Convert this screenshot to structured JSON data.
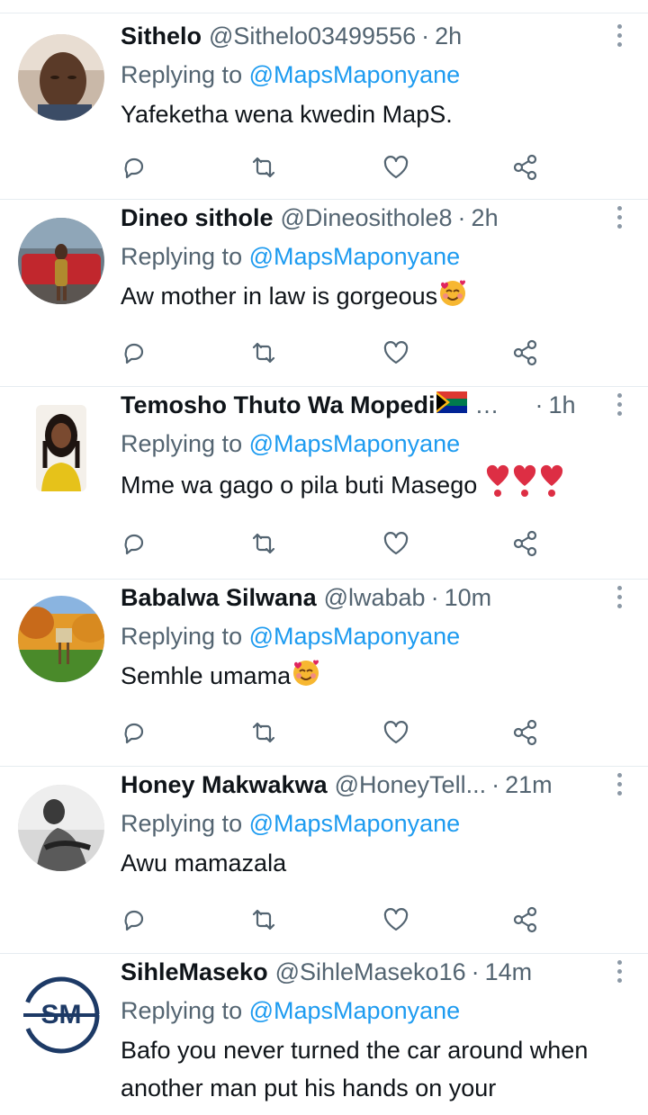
{
  "tweets": [
    {
      "name": "Sithelo",
      "handle": "@Sithelo03499556",
      "separator": "·",
      "time": "2h",
      "replying_prefix": "Replying to",
      "replying_to": "@MapsMaponyane",
      "text": "Yafeketha wena kwedin MapS.",
      "avatar": "man-face-avatar"
    },
    {
      "name": "Dineo sithole",
      "handle": "@Dineosithole8",
      "separator": "·",
      "time": "2h",
      "replying_prefix": "Replying to",
      "replying_to": "@MapsMaponyane",
      "text": "Aw mother in law is gorgeous",
      "emoji": "smiling-face-with-hearts",
      "avatar": "woman-red-car-avatar"
    },
    {
      "name": "Temosho Thuto Wa Mopedi",
      "handle": "…",
      "separator": "·",
      "time": "1h",
      "replying_prefix": "Replying to",
      "replying_to": "@MapsMaponyane",
      "text": "Mme wa gago o pila buti Masego ",
      "emoji": "red-heart-exclamation ×3",
      "flag": "south-africa-flag",
      "avatar": "woman-braids-avatar"
    },
    {
      "name": "Babalwa Silwana",
      "handle": "@lwabab",
      "separator": "·",
      "time": "10m",
      "replying_prefix": "Replying to",
      "replying_to": "@MapsMaponyane",
      "text": "Semhle umama",
      "emoji": "smiling-face-with-hearts",
      "avatar": "landscape-sign-avatar"
    },
    {
      "name": "Honey Makwakwa",
      "handle": "@HoneyTell...",
      "separator": "·",
      "time": "21m",
      "replying_prefix": "Replying to",
      "replying_to": "@MapsMaponyane",
      "text": "Awu mamazala",
      "avatar": "bw-portrait-avatar"
    },
    {
      "name": "SihleMaseko",
      "handle": "@SihleMaseko16",
      "separator": "·",
      "time": "14m",
      "replying_prefix": "Replying to",
      "replying_to": "@MapsMaponyane",
      "text": "Bafo you never turned the car around when another man put his hands on your",
      "avatar": "sm-logo-avatar",
      "logo_text": "SM"
    }
  ],
  "colors": {
    "link": "#1d9bf0",
    "secondary": "#536471",
    "icon": "#536471",
    "divider": "#e6ecf0"
  }
}
